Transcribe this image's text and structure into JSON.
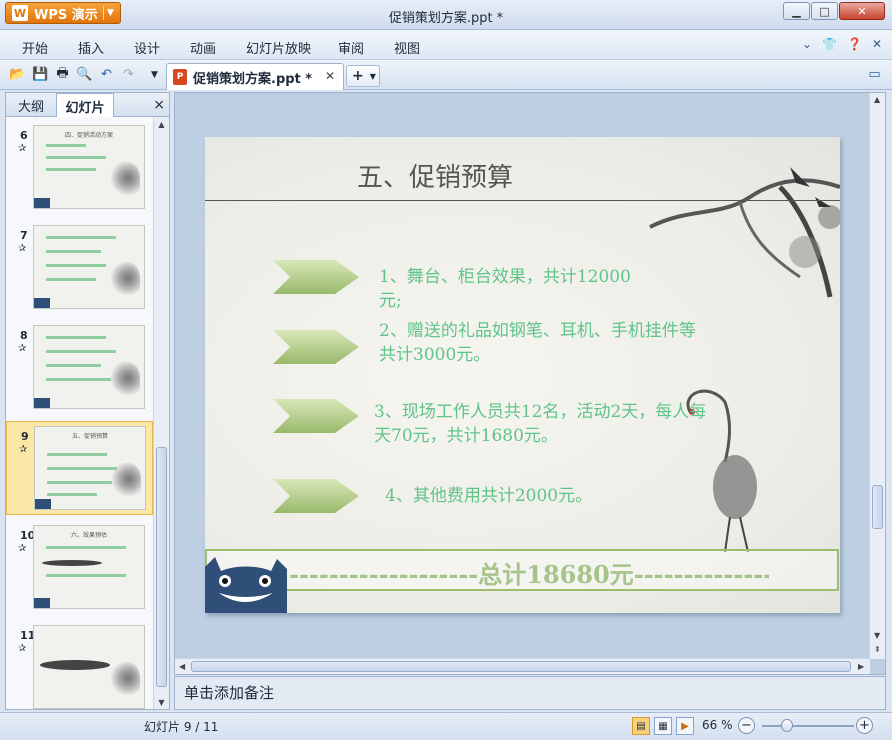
{
  "app": {
    "name": "WPS 演示",
    "logo_text": "W",
    "window_title": "促销策划方案.ppt *"
  },
  "menu": [
    "开始",
    "插入",
    "设计",
    "动画",
    "幻灯片放映",
    "审阅",
    "视图"
  ],
  "toolbar": {
    "document_tab": "促销策划方案.ppt *",
    "new_tab_label": "+"
  },
  "left_panel": {
    "tab_outline": "大纲",
    "tab_slides": "幻灯片",
    "close_label": "×",
    "thumbnails": [
      {
        "num": "6",
        "title": "四、促销活动方案"
      },
      {
        "num": "7",
        "title": ""
      },
      {
        "num": "8",
        "title": ""
      },
      {
        "num": "9",
        "title": "五、促销预算"
      },
      {
        "num": "10",
        "title": "六、效果预估"
      },
      {
        "num": "11",
        "title": ""
      }
    ],
    "selected_slide": "9"
  },
  "slide": {
    "title": "五、促销预算",
    "bullets": [
      {
        "line1": "1、舞台、柜台效果，共计12000",
        "line2": "元;"
      },
      {
        "line1": "2、赠送的礼品如钢笔、耳机、手机挂件等",
        "line2": "共计3000元。"
      },
      {
        "line1": "3、现场工作人员共12名，活动2天，每人每",
        "line2": "天70元，共计1680元。"
      },
      {
        "line1": "4、其他费用共计2000元。",
        "line2": ""
      }
    ],
    "total": "-------------------总计18680元------------------"
  },
  "notes": {
    "placeholder": "单击添加备注"
  },
  "status": {
    "slide_indicator": "幻灯片 9 / 11",
    "zoom": "66 %"
  },
  "colors": {
    "accent_green": "#5fc488",
    "total_green": "#a6c38a",
    "app_orange": "#e0750d"
  }
}
